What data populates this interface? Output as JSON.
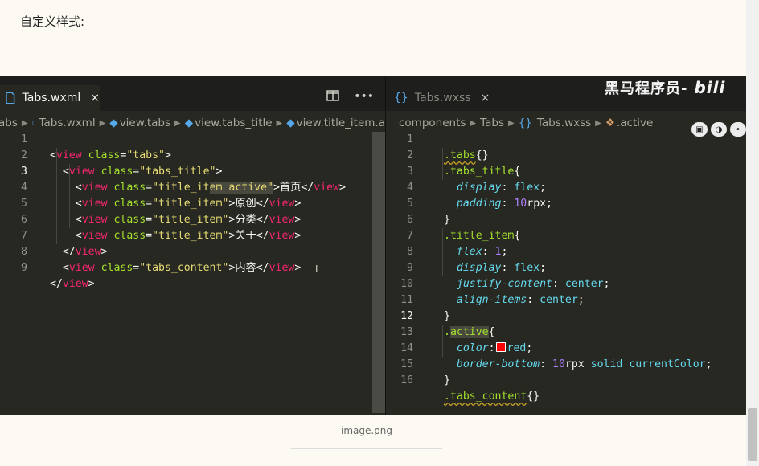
{
  "page": {
    "heading": "自定义样式:",
    "caption": "image.png"
  },
  "watermark": {
    "text": "黑马程序员-",
    "logo": "bili"
  },
  "left_editor": {
    "tab_label": "Tabs.wxml",
    "tab_close": "×",
    "breadcrumb": [
      "abs",
      "Tabs.wxml",
      "view.tabs",
      "view.tabs_title",
      "view.title_item.a"
    ],
    "lines": [
      "1",
      "2",
      "3",
      "4",
      "5",
      "6",
      "7",
      "8",
      "9"
    ],
    "code": {
      "l3_text": "首页",
      "l4_text": "原创",
      "l5_text": "分类",
      "l6_text": "关于",
      "l8_text": "内容"
    }
  },
  "right_editor": {
    "tab_label": "Tabs.wxss",
    "tab_close": "×",
    "breadcrumb": [
      "components",
      "Tabs",
      "Tabs.wxss",
      ".active"
    ],
    "lines": [
      "1",
      "2",
      "3",
      "4",
      "5",
      "6",
      "7",
      "8",
      "9",
      "10",
      "11",
      "12",
      "13",
      "14",
      "15",
      "16"
    ]
  },
  "colors": {
    "editor_bg": "#272822",
    "tag": "#f92672",
    "attr": "#a6e22e",
    "string": "#e6db74",
    "keyword": "#66d9ef",
    "number": "#ae81ff"
  },
  "icons": [
    "file-icon",
    "split-editor-icon",
    "more-icon",
    "close-icon",
    "braces-icon",
    "chevron-right-icon",
    "cube-icon"
  ]
}
